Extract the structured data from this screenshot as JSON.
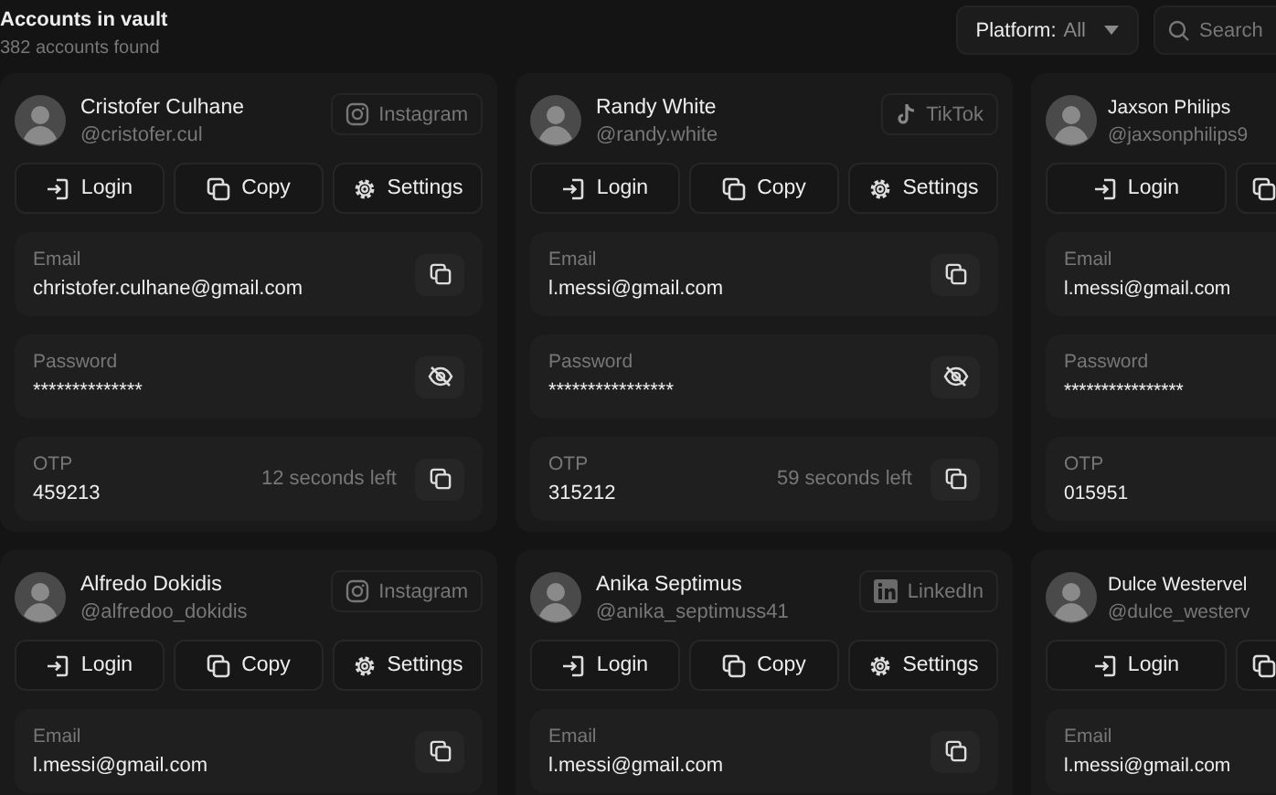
{
  "header": {
    "title": "Accounts in vault",
    "subtitle": "382 accounts found",
    "platform_filter": {
      "label": "Platform:",
      "value": "All"
    },
    "search": {
      "placeholder": "Search"
    }
  },
  "accounts": [
    {
      "name": "Cristofer Culhane",
      "handle": "@cristofer.cul",
      "platform": {
        "kind": "instagram",
        "label": "Instagram"
      },
      "buttons": [
        {
          "kind": "login",
          "label": "Login"
        },
        {
          "kind": "copy",
          "label": "Copy"
        },
        {
          "kind": "settings",
          "label": "Settings"
        }
      ],
      "fields": [
        {
          "label": "Email",
          "value": "christofer.culhane@gmail.com",
          "kind": "copyable"
        },
        {
          "label": "Password",
          "value": "**************",
          "kind": "secret"
        },
        {
          "label": "OTP",
          "value": "459213",
          "timer": "12 seconds left",
          "kind": "copyable"
        }
      ]
    },
    {
      "name": "Randy White",
      "handle": "@randy.white",
      "platform": {
        "kind": "tiktok",
        "label": "TikTok"
      },
      "buttons": [
        {
          "kind": "login",
          "label": "Login"
        },
        {
          "kind": "copy",
          "label": "Copy"
        },
        {
          "kind": "settings",
          "label": "Settings"
        }
      ],
      "fields": [
        {
          "label": "Email",
          "value": "l.messi@gmail.com",
          "kind": "copyable"
        },
        {
          "label": "Password",
          "value": "****************",
          "kind": "secret"
        },
        {
          "label": "OTP",
          "value": "315212",
          "timer": "59 seconds left",
          "kind": "copyable"
        }
      ]
    },
    {
      "name": "Jaxson Philips",
      "handle": "@jaxsonphilips9",
      "buttons": [
        {
          "kind": "login",
          "label": "Login"
        },
        {
          "kind": "copy"
        }
      ],
      "fields": [
        {
          "label": "Email",
          "value": "l.messi@gmail.com"
        },
        {
          "label": "Password",
          "value": "****************"
        },
        {
          "label": "OTP",
          "value": "015951"
        }
      ]
    },
    {
      "name": "Alfredo Dokidis",
      "handle": "@alfredoo_dokidis",
      "platform": {
        "kind": "instagram",
        "label": "Instagram"
      },
      "buttons": [
        {
          "kind": "login",
          "label": "Login"
        },
        {
          "kind": "copy",
          "label": "Copy"
        },
        {
          "kind": "settings",
          "label": "Settings"
        }
      ],
      "fields": [
        {
          "label": "Email",
          "value": "l.messi@gmail.com",
          "kind": "copyable"
        }
      ]
    },
    {
      "name": "Anika Septimus",
      "handle": "@anika_septimuss41",
      "platform": {
        "kind": "linkedin",
        "label": "LinkedIn"
      },
      "buttons": [
        {
          "kind": "login",
          "label": "Login"
        },
        {
          "kind": "copy",
          "label": "Copy"
        },
        {
          "kind": "settings",
          "label": "Settings"
        }
      ],
      "fields": [
        {
          "label": "Email",
          "value": "l.messi@gmail.com",
          "kind": "copyable"
        }
      ]
    },
    {
      "name": "Dulce Westervel",
      "handle": "@dulce_westerv",
      "buttons": [
        {
          "kind": "login",
          "label": "Login"
        },
        {
          "kind": "copy"
        }
      ],
      "fields": [
        {
          "label": "Email",
          "value": "l.messi@gmail.com"
        }
      ]
    }
  ]
}
